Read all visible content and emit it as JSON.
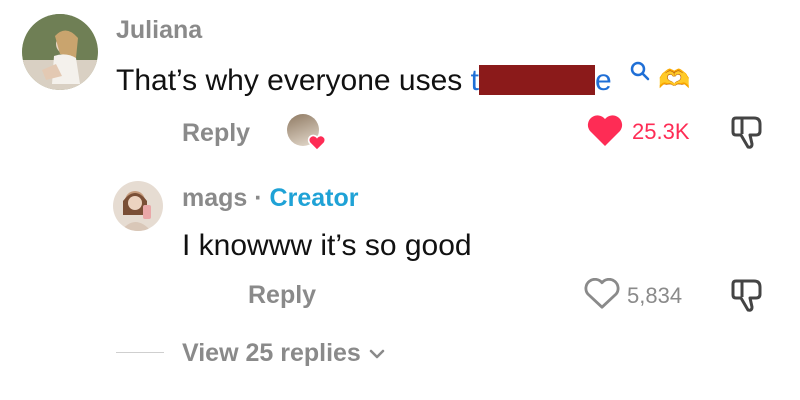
{
  "comments": [
    {
      "author": "Juliana",
      "text": "That’s why everyone uses ",
      "link_start": "t",
      "link_end": "e",
      "emoji": "🫶",
      "reply_label": "Reply",
      "likes": "25.3K",
      "liked": true
    },
    {
      "author": "mags",
      "separator": " · ",
      "badge": "Creator",
      "text": "I knowww it’s so good",
      "reply_label": "Reply",
      "likes": "5,834",
      "liked": false
    }
  ],
  "view_replies": "View 25 replies",
  "colors": {
    "liked": "#fe2c55",
    "muted": "#8a8a8a",
    "creator": "#1fa2d6",
    "link": "#1f6fd6",
    "redaction": "#8b1a1a"
  }
}
